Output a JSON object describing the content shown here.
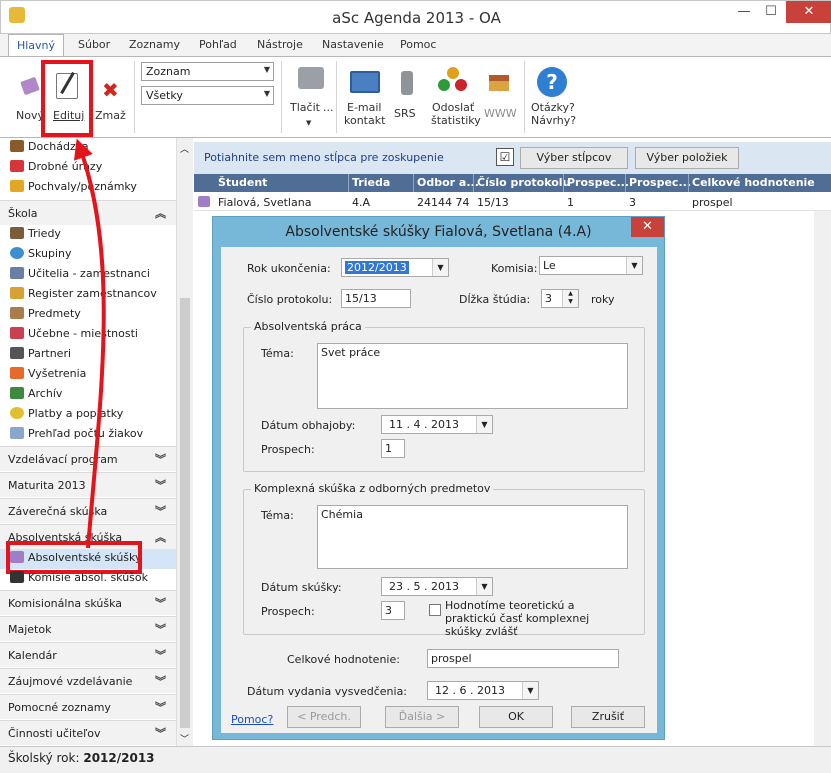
{
  "window": {
    "title": "aSc Agenda 2013 - OA",
    "min": "—",
    "max": "☐",
    "close": "✕"
  },
  "ribbon_tabs": [
    "Hlavný",
    "Súbor",
    "Zoznamy",
    "Pohľad",
    "Nástroje",
    "Nastavenie",
    "Pomoc"
  ],
  "ribbon": {
    "new": "Nový",
    "edit": "Edituj",
    "delete": "Zmaž",
    "combo1": "Zoznam",
    "combo2": "Všetky",
    "print1": "Tlačit",
    "print2": "...",
    "email1": "E-mail",
    "email2": "kontakt",
    "srs": "SRS",
    "stats1": "Odoslať",
    "stats2": "štatistiky",
    "www": "WWW",
    "help1": "Otázky?",
    "help2": "Návrhy?"
  },
  "sidebar": {
    "top_items": [
      "Dochádzka",
      "Drobné úrazy",
      "Pochvaly/poznámky"
    ],
    "skola_header": "Škola",
    "skola_items": [
      "Triedy",
      "Skupiny",
      "Učitelia - zamestnanci",
      "Register zamestnancov",
      "Predmety",
      "Učebne - miestnosti",
      "Partneri",
      "Vyšetrenia",
      "Archív",
      "Platby a poplatky",
      "Prehľad počtu žiakov"
    ],
    "headers_mid": [
      "Vzdelávací program",
      "Maturita 2013",
      "Záverečná skúška",
      "Absolventská skúška"
    ],
    "abs_items": [
      "Absolventské skúšky",
      "Komisie absol. skúšok"
    ],
    "headers_bottom": [
      "Komisionálna skúška",
      "Majetok",
      "Kalendár",
      "Záujmové vzdelávanie",
      "Pomocné zoznamy",
      "Činnosti učiteľov"
    ]
  },
  "grid": {
    "group_hint": "Potiahnite sem meno stĺpca pre zoskupenie",
    "btn_columns": "Výber stĺpcov",
    "btn_items": "Výber položiek",
    "checkbox": "☑",
    "headers": [
      "Študent",
      "Trieda",
      "Odbor a...",
      "Číslo protokolu",
      "Prospec...",
      "Prospec...",
      "Celkové hodnotenie"
    ],
    "row": [
      "Fialová, Svetlana",
      "4.A",
      "24144 74",
      "15/13",
      "1",
      "3",
      "prospel"
    ]
  },
  "dialog": {
    "title": "Absolventské skúšky Fialová, Svetlana (4.A)",
    "close": "✕",
    "rok_label": "Rok ukončenia:",
    "rok_value": "2012/2013",
    "komisia_label": "Komisia:",
    "komisia_value": "Le",
    "protokol_label": "Číslo protokolu:",
    "protokol_value": "15/13",
    "dlzka_label": "Dĺžka štúdia:",
    "dlzka_value": "3",
    "roky": "roky",
    "praca_group": "Absolventská práca",
    "tema_label": "Téma:",
    "praca_tema": "Svet práce",
    "obhajoba_label": "Dátum obhajoby:",
    "obhajoba_value": "11 .  4 . 2013",
    "prospech_label": "Prospech:",
    "praca_prospech": "1",
    "komplex_group": "Komplexná skúška z odborných predmetov",
    "komplex_tema": "Chémia",
    "skuska_label": "Dátum skúšky:",
    "skuska_value": "23 .  5 . 2013",
    "komplex_prospech": "3",
    "checkbox_text": "Hodnotíme teoretickú a praktickú časť komplexnej skúšky zvlášť",
    "celkove_label": "Celkové hodnotenie:",
    "celkove_value": "prospel",
    "vydanie_label": "Dátum vydania vysvedčenia:",
    "vydanie_value": "12 .  6 . 2013",
    "help": "Pomoc?",
    "prev": "< Predch.",
    "next": "Ďalšia >",
    "ok": "OK",
    "cancel": "Zrušiť"
  },
  "status": {
    "label": "Školský rok:",
    "value": "2012/2013"
  }
}
